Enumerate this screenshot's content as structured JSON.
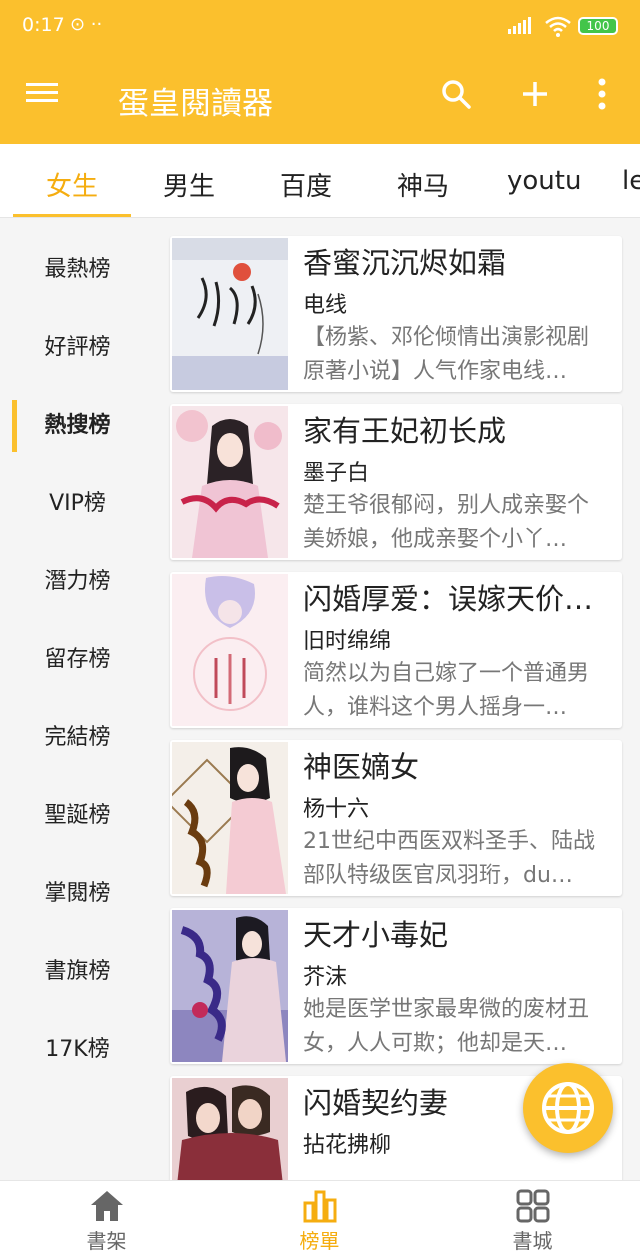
{
  "status_bar": {
    "time": "0:17",
    "extra": "⊙ ··",
    "battery": "100"
  },
  "app": {
    "title": "蛋皇閱讀器",
    "menu_icon": "menu-icon",
    "search_icon": "search-icon",
    "add_icon": "add-icon",
    "more_icon": "more-vert-icon"
  },
  "tabs": [
    {
      "label": "女生"
    },
    {
      "label": "男生"
    },
    {
      "label": "百度"
    },
    {
      "label": "神马"
    },
    {
      "label": "youtu"
    },
    {
      "label": "le"
    }
  ],
  "sidebar": {
    "items": [
      {
        "label": "最熱榜"
      },
      {
        "label": "好評榜"
      },
      {
        "label": "熱搜榜"
      },
      {
        "label": "VIP榜"
      },
      {
        "label": "潛力榜"
      },
      {
        "label": "留存榜"
      },
      {
        "label": "完結榜"
      },
      {
        "label": "聖誕榜"
      },
      {
        "label": "掌閱榜"
      },
      {
        "label": "書旗榜"
      },
      {
        "label": "17K榜"
      }
    ],
    "active_index": 2
  },
  "books": [
    {
      "title": "香蜜沉沉烬如霜",
      "author": "电线",
      "desc": "【杨紫、邓伦倾情出演影视剧原著小说】人气作家电线…"
    },
    {
      "title": "家有王妃初长成",
      "author": "墨子白",
      "desc": "楚王爷很郁闷，别人成亲娶个美娇娘，他成亲娶个小丫…"
    },
    {
      "title": "闪婚厚爱：误嫁天价…",
      "author": "旧时绵绵",
      "desc": "简然以为自己嫁了一个普通男人，谁料这个男人摇身一…"
    },
    {
      "title": "神医嫡女",
      "author": "杨十六",
      "desc": "21世纪中西医双料圣手、陆战部队特级医官凤羽珩，du…"
    },
    {
      "title": "天才小毒妃",
      "author": "芥沫",
      "desc": "她是医学世家最卑微的废材丑女，人人可欺；他却是天…"
    },
    {
      "title": "闪婚契约妻",
      "author": "拈花拂柳",
      "desc": ""
    }
  ],
  "fab": {
    "icon": "globe-icon"
  },
  "bottom_nav": [
    {
      "label": "書架",
      "icon": "home-icon"
    },
    {
      "label": "榜單",
      "icon": "chart-bars-icon"
    },
    {
      "label": "書城",
      "icon": "grid-icon"
    }
  ],
  "colors": {
    "primary": "#fbc02d",
    "accent_text": "#f5ad10"
  }
}
